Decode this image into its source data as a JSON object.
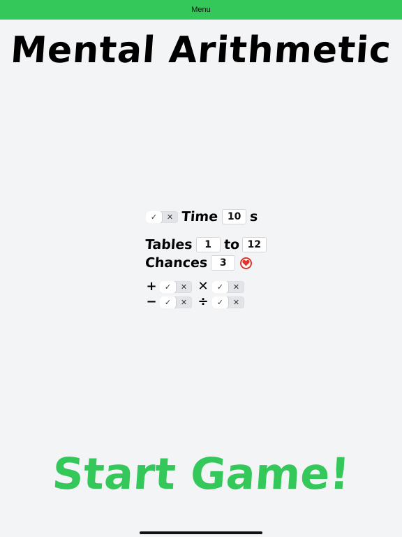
{
  "menu": {
    "label": "Menu"
  },
  "title": "Mental Arithmetic",
  "time": {
    "label": "Time",
    "value": "10",
    "unit": "s",
    "enabled": true
  },
  "tables": {
    "label": "Tables",
    "from": "1",
    "to_label": "to",
    "to": "12"
  },
  "chances": {
    "label": "Chances",
    "value": "3"
  },
  "toggle_glyphs": {
    "on": "✓",
    "off": "✕"
  },
  "operations": {
    "add": {
      "symbol": "+",
      "enabled": true
    },
    "multiply": {
      "symbol": "✕",
      "enabled": true
    },
    "subtract": {
      "symbol": "−",
      "enabled": true
    },
    "divide": {
      "symbol": "÷",
      "enabled": true
    }
  },
  "start_button": {
    "label": "Start Game!"
  },
  "colors": {
    "accent": "#34c759",
    "background": "#f3f4f6",
    "heart": "#e0352b"
  }
}
